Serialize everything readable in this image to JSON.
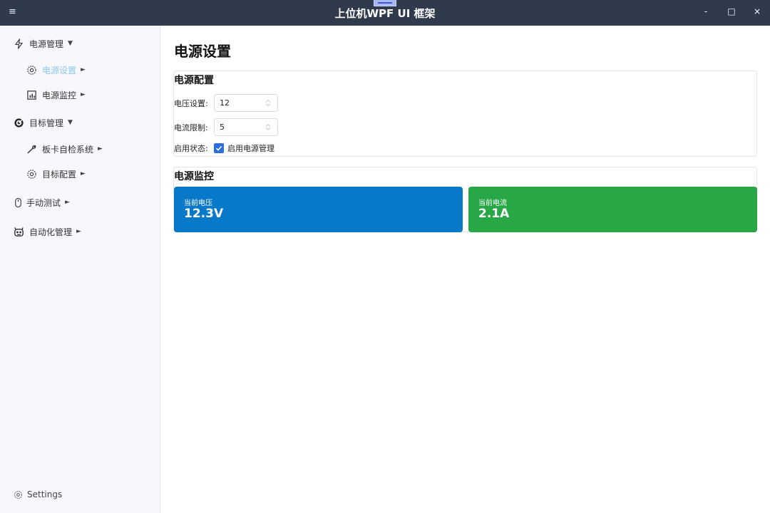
{
  "window": {
    "title": "上位机WPF UI 框架",
    "menu_glyph": "≡",
    "minimize": "-",
    "maximize": "□",
    "close": "×"
  },
  "sidebar": {
    "items": [
      {
        "label": "电源管理",
        "icon": "lightning-icon",
        "arrow": "▼"
      },
      {
        "label": "电源设置",
        "icon": "gear-icon",
        "arrow": "►",
        "active": true
      },
      {
        "label": "电源监控",
        "icon": "bar-chart-icon",
        "arrow": "►"
      },
      {
        "label": "目标管理",
        "icon": "target-icon",
        "arrow": "▼"
      },
      {
        "label": "板卡自检系统",
        "icon": "wrench-icon",
        "arrow": "►"
      },
      {
        "label": "目标配置",
        "icon": "gear-icon",
        "arrow": "►"
      },
      {
        "label": "手动测试",
        "icon": "mouse-icon",
        "arrow": "►"
      },
      {
        "label": "自动化管理",
        "icon": "robot-icon",
        "arrow": "►"
      }
    ],
    "settings_label": "Settings"
  },
  "main": {
    "page_title": "电源设置",
    "config": {
      "title": "电源配置",
      "voltage_label": "电压设置:",
      "voltage_value": "12",
      "current_label": "电流限制:",
      "current_value": "5",
      "enable_label": "启用状态:",
      "enable_checkbox_label": "启用电源管理",
      "enable_checked": true
    },
    "monitor": {
      "title": "电源监控",
      "voltage_card_label": "当前电压",
      "voltage_card_value": "12.3V",
      "current_card_label": "当前电流",
      "current_card_value": "2.1A"
    }
  },
  "colors": {
    "titlebar": "#2f3a4c",
    "voltage_card": "#0878c8",
    "current_card": "#27a745",
    "checkbox": "#2f6fdd",
    "active_nav": "#8ec5e6"
  }
}
